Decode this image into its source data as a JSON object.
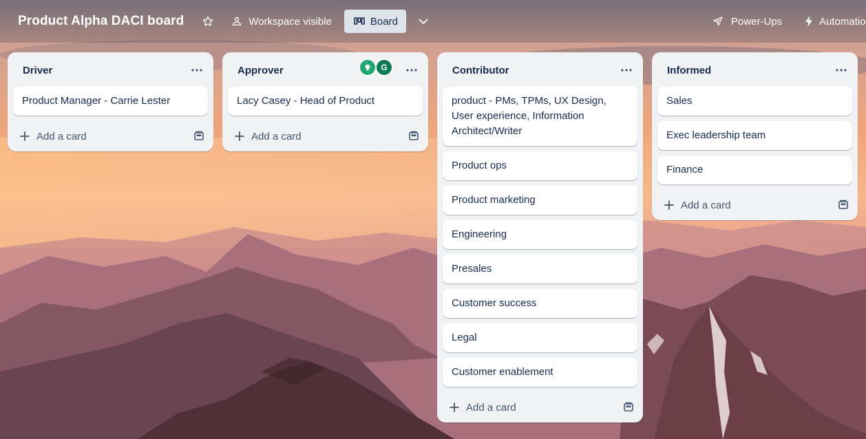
{
  "header": {
    "board_title": "Product Alpha DACI board",
    "visibility_label": "Workspace visible",
    "view_label": "Board",
    "powerups_label": "Power-Ups",
    "automation_label": "Automation"
  },
  "icons": {
    "star": "star-icon",
    "visibility": "people-icon",
    "board_view": "board-columns-icon",
    "dropdown": "chevron-down-icon",
    "powerups": "rocket-icon",
    "automation": "lightning-icon",
    "list_menu": "more-horizontal-icon",
    "add": "plus-icon",
    "template": "card-template-icon"
  },
  "add_card_label": "Add a card",
  "lists": [
    {
      "title": "Driver",
      "cards": [
        "Product Manager - Carrie Lester"
      ]
    },
    {
      "title": "Approver",
      "avatars": [
        "",
        "G"
      ],
      "cards": [
        "Lacy Casey - Head of Product"
      ]
    },
    {
      "title": "Contributor",
      "cards": [
        "product - PMs, TPMs, UX Design, User experience, Information Architect/Writer",
        "Product ops",
        "Product marketing",
        "Engineering",
        "Presales",
        "Customer success",
        "Legal",
        "Customer enablement"
      ]
    },
    {
      "title": "Informed",
      "cards": [
        "Sales",
        "Exec leadership team",
        "Finance"
      ]
    }
  ],
  "colors": {
    "list_bg": "#f1f2f4",
    "card_text": "#172b4d",
    "view_button_bg": "#dfe3ea",
    "avatar_1": "#1fa870",
    "avatar_2": "#0e7a57"
  }
}
